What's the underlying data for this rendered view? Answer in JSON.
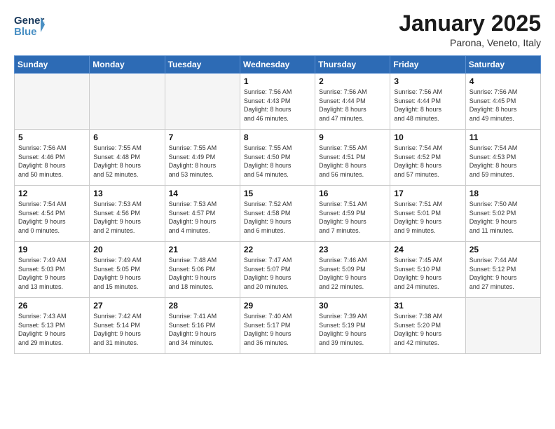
{
  "header": {
    "logo_line1": "General",
    "logo_line2": "Blue",
    "title": "January 2025",
    "subtitle": "Parona, Veneto, Italy"
  },
  "weekdays": [
    "Sunday",
    "Monday",
    "Tuesday",
    "Wednesday",
    "Thursday",
    "Friday",
    "Saturday"
  ],
  "weeks": [
    [
      {
        "num": "",
        "info": ""
      },
      {
        "num": "",
        "info": ""
      },
      {
        "num": "",
        "info": ""
      },
      {
        "num": "1",
        "info": "Sunrise: 7:56 AM\nSunset: 4:43 PM\nDaylight: 8 hours\nand 46 minutes."
      },
      {
        "num": "2",
        "info": "Sunrise: 7:56 AM\nSunset: 4:44 PM\nDaylight: 8 hours\nand 47 minutes."
      },
      {
        "num": "3",
        "info": "Sunrise: 7:56 AM\nSunset: 4:44 PM\nDaylight: 8 hours\nand 48 minutes."
      },
      {
        "num": "4",
        "info": "Sunrise: 7:56 AM\nSunset: 4:45 PM\nDaylight: 8 hours\nand 49 minutes."
      }
    ],
    [
      {
        "num": "5",
        "info": "Sunrise: 7:56 AM\nSunset: 4:46 PM\nDaylight: 8 hours\nand 50 minutes."
      },
      {
        "num": "6",
        "info": "Sunrise: 7:55 AM\nSunset: 4:48 PM\nDaylight: 8 hours\nand 52 minutes."
      },
      {
        "num": "7",
        "info": "Sunrise: 7:55 AM\nSunset: 4:49 PM\nDaylight: 8 hours\nand 53 minutes."
      },
      {
        "num": "8",
        "info": "Sunrise: 7:55 AM\nSunset: 4:50 PM\nDaylight: 8 hours\nand 54 minutes."
      },
      {
        "num": "9",
        "info": "Sunrise: 7:55 AM\nSunset: 4:51 PM\nDaylight: 8 hours\nand 56 minutes."
      },
      {
        "num": "10",
        "info": "Sunrise: 7:54 AM\nSunset: 4:52 PM\nDaylight: 8 hours\nand 57 minutes."
      },
      {
        "num": "11",
        "info": "Sunrise: 7:54 AM\nSunset: 4:53 PM\nDaylight: 8 hours\nand 59 minutes."
      }
    ],
    [
      {
        "num": "12",
        "info": "Sunrise: 7:54 AM\nSunset: 4:54 PM\nDaylight: 9 hours\nand 0 minutes."
      },
      {
        "num": "13",
        "info": "Sunrise: 7:53 AM\nSunset: 4:56 PM\nDaylight: 9 hours\nand 2 minutes."
      },
      {
        "num": "14",
        "info": "Sunrise: 7:53 AM\nSunset: 4:57 PM\nDaylight: 9 hours\nand 4 minutes."
      },
      {
        "num": "15",
        "info": "Sunrise: 7:52 AM\nSunset: 4:58 PM\nDaylight: 9 hours\nand 6 minutes."
      },
      {
        "num": "16",
        "info": "Sunrise: 7:51 AM\nSunset: 4:59 PM\nDaylight: 9 hours\nand 7 minutes."
      },
      {
        "num": "17",
        "info": "Sunrise: 7:51 AM\nSunset: 5:01 PM\nDaylight: 9 hours\nand 9 minutes."
      },
      {
        "num": "18",
        "info": "Sunrise: 7:50 AM\nSunset: 5:02 PM\nDaylight: 9 hours\nand 11 minutes."
      }
    ],
    [
      {
        "num": "19",
        "info": "Sunrise: 7:49 AM\nSunset: 5:03 PM\nDaylight: 9 hours\nand 13 minutes."
      },
      {
        "num": "20",
        "info": "Sunrise: 7:49 AM\nSunset: 5:05 PM\nDaylight: 9 hours\nand 15 minutes."
      },
      {
        "num": "21",
        "info": "Sunrise: 7:48 AM\nSunset: 5:06 PM\nDaylight: 9 hours\nand 18 minutes."
      },
      {
        "num": "22",
        "info": "Sunrise: 7:47 AM\nSunset: 5:07 PM\nDaylight: 9 hours\nand 20 minutes."
      },
      {
        "num": "23",
        "info": "Sunrise: 7:46 AM\nSunset: 5:09 PM\nDaylight: 9 hours\nand 22 minutes."
      },
      {
        "num": "24",
        "info": "Sunrise: 7:45 AM\nSunset: 5:10 PM\nDaylight: 9 hours\nand 24 minutes."
      },
      {
        "num": "25",
        "info": "Sunrise: 7:44 AM\nSunset: 5:12 PM\nDaylight: 9 hours\nand 27 minutes."
      }
    ],
    [
      {
        "num": "26",
        "info": "Sunrise: 7:43 AM\nSunset: 5:13 PM\nDaylight: 9 hours\nand 29 minutes."
      },
      {
        "num": "27",
        "info": "Sunrise: 7:42 AM\nSunset: 5:14 PM\nDaylight: 9 hours\nand 31 minutes."
      },
      {
        "num": "28",
        "info": "Sunrise: 7:41 AM\nSunset: 5:16 PM\nDaylight: 9 hours\nand 34 minutes."
      },
      {
        "num": "29",
        "info": "Sunrise: 7:40 AM\nSunset: 5:17 PM\nDaylight: 9 hours\nand 36 minutes."
      },
      {
        "num": "30",
        "info": "Sunrise: 7:39 AM\nSunset: 5:19 PM\nDaylight: 9 hours\nand 39 minutes."
      },
      {
        "num": "31",
        "info": "Sunrise: 7:38 AM\nSunset: 5:20 PM\nDaylight: 9 hours\nand 42 minutes."
      },
      {
        "num": "",
        "info": ""
      }
    ]
  ]
}
